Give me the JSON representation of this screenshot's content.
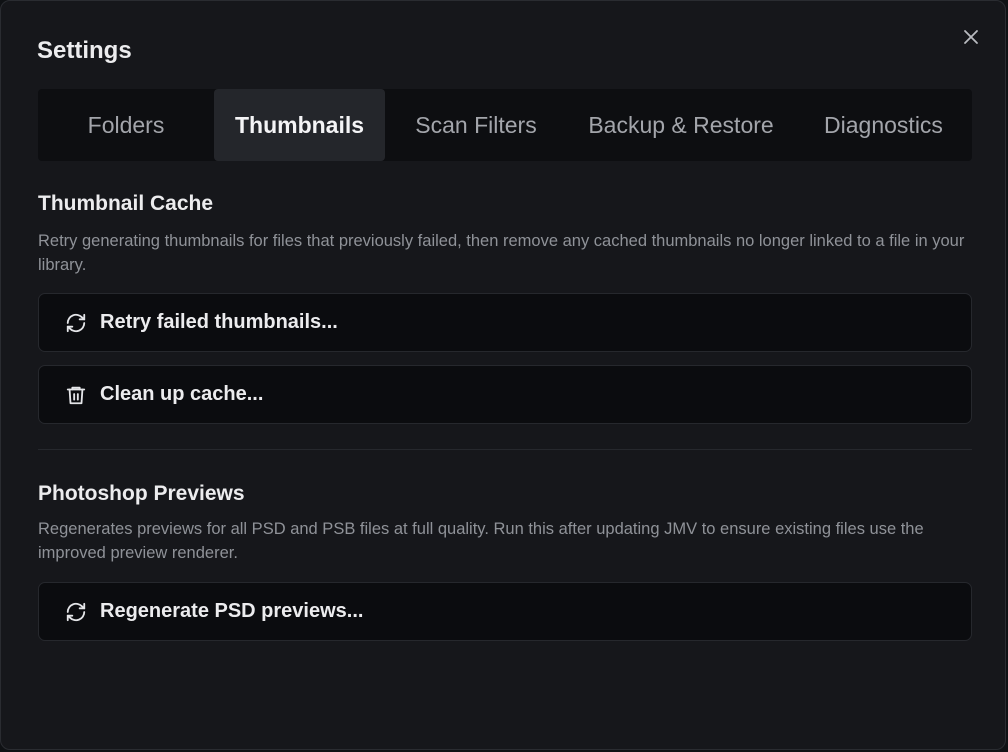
{
  "dialog": {
    "title": "Settings",
    "close_icon": "close-icon"
  },
  "tabs": [
    {
      "label": "Folders",
      "active": false
    },
    {
      "label": "Thumbnails",
      "active": true
    },
    {
      "label": "Scan Filters",
      "active": false
    },
    {
      "label": "Backup & Restore",
      "active": false
    },
    {
      "label": "Diagnostics",
      "active": false
    }
  ],
  "thumbnail_cache": {
    "title": "Thumbnail Cache",
    "description": "Retry generating thumbnails for files that previously failed, then remove any cached thumbnails no longer linked to a file in your library.",
    "retry_button": {
      "label": "Retry failed thumbnails...",
      "icon": "refresh-icon"
    },
    "cleanup_button": {
      "label": "Clean up cache...",
      "icon": "trash-icon"
    }
  },
  "photoshop_previews": {
    "title": "Photoshop Previews",
    "description": "Regenerates previews for all PSD and PSB files at full quality. Run this after updating JMV to ensure existing files use the improved preview renderer.",
    "regenerate_button": {
      "label": "Regenerate PSD previews...",
      "icon": "refresh-icon"
    }
  },
  "colors": {
    "background": "#16171b",
    "tab_bar": "#0d0e11",
    "tab_active": "#24262b",
    "button_bg": "#0b0c0f",
    "text_primary": "#ececee",
    "text_secondary": "#8f9298"
  }
}
